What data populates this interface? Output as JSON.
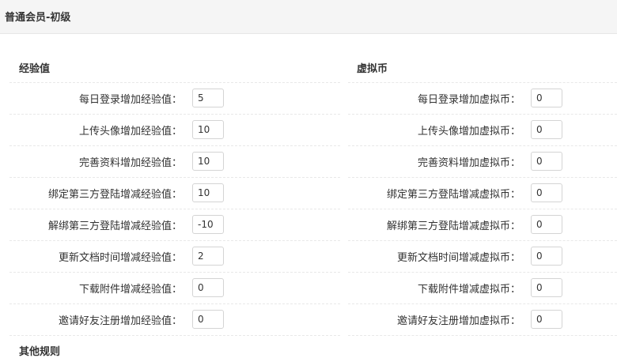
{
  "page_title": "普通会员-初级",
  "left": {
    "title": "经验值",
    "rows": [
      {
        "label": "每日登录增加经验值：",
        "value": "5"
      },
      {
        "label": "上传头像增加经验值：",
        "value": "10"
      },
      {
        "label": "完善资料增加经验值：",
        "value": "10"
      },
      {
        "label": "绑定第三方登陆增减经验值：",
        "value": "10"
      },
      {
        "label": "解绑第三方登陆增减经验值：",
        "value": "-10"
      },
      {
        "label": "更新文档时间增减经验值：",
        "value": "2"
      },
      {
        "label": "下载附件增减经验值：",
        "value": "0"
      },
      {
        "label": "邀请好友注册增加经验值：",
        "value": "0"
      }
    ]
  },
  "right": {
    "title": "虚拟币",
    "rows": [
      {
        "label": "每日登录增加虚拟币：",
        "value": "0"
      },
      {
        "label": "上传头像增加虚拟币：",
        "value": "0"
      },
      {
        "label": "完善资料增加虚拟币：",
        "value": "0"
      },
      {
        "label": "绑定第三方登陆增减虚拟币：",
        "value": "0"
      },
      {
        "label": "解绑第三方登陆增减虚拟币：",
        "value": "0"
      },
      {
        "label": "更新文档时间增减虚拟币：",
        "value": "0"
      },
      {
        "label": "下载附件增减虚拟币：",
        "value": "0"
      },
      {
        "label": "邀请好友注册增加虚拟币：",
        "value": "0"
      }
    ]
  },
  "next_section_title": "其他规则"
}
